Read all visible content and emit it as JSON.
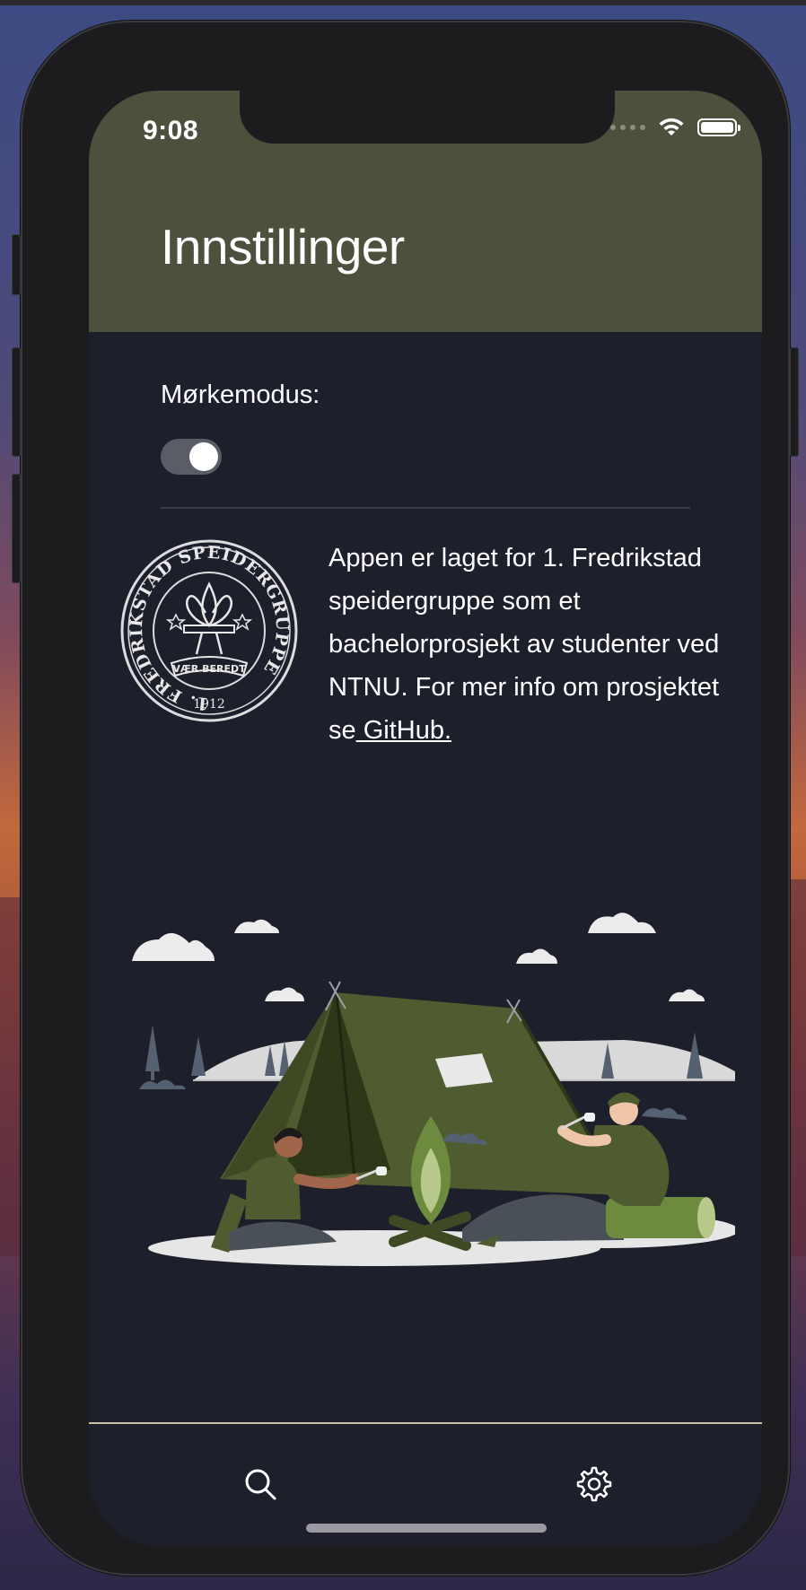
{
  "status_bar": {
    "time": "9:08"
  },
  "header": {
    "title": "Innstillinger"
  },
  "settings": {
    "dark_mode_label": "Mørkemodus:",
    "dark_mode_on": true
  },
  "logo": {
    "text": "1. FREDRIKSTAD SPEIDERGRUPPE",
    "motto": "VÆR BEREDT",
    "year": "1912"
  },
  "about": {
    "text": "Appen er laget for 1. Fredrikstad speidergruppe som et bachelorprosjekt av studenter ved NTNU. For mer info om prosjektet se",
    "link_text": " GitHub."
  },
  "tabbar": {
    "tabs": [
      {
        "icon": "search-icon"
      },
      {
        "icon": "gear-icon"
      }
    ]
  },
  "colors": {
    "header_bg": "#4b513d",
    "screen_bg": "#1d1f2b",
    "tent_green": "#4f5c2f",
    "tabbar_border": "#c9c2a8"
  }
}
